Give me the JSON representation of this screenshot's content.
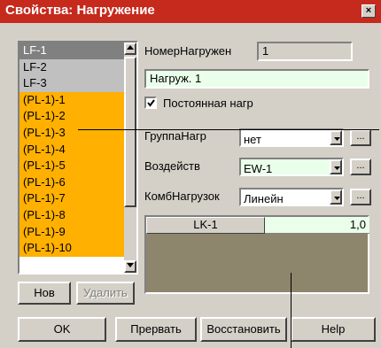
{
  "window": {
    "title": "Свойства: Нагружение",
    "close_glyph": "×"
  },
  "load_list": {
    "items": [
      {
        "label": "LF-1",
        "style": "sel"
      },
      {
        "label": "LF-2",
        "style": "gray"
      },
      {
        "label": "LF-3",
        "style": "gray"
      },
      {
        "label": "(PL-1)-1",
        "style": "orange"
      },
      {
        "label": "(PL-1)-2",
        "style": "orange"
      },
      {
        "label": "(PL-1)-3",
        "style": "orange"
      },
      {
        "label": "(PL-1)-4",
        "style": "orange"
      },
      {
        "label": "(PL-1)-5",
        "style": "orange"
      },
      {
        "label": "(PL-1)-6",
        "style": "orange"
      },
      {
        "label": "(PL-1)-7",
        "style": "orange"
      },
      {
        "label": "(PL-1)-8",
        "style": "orange"
      },
      {
        "label": "(PL-1)-9",
        "style": "orange"
      },
      {
        "label": "(PL-1)-10",
        "style": "orange"
      }
    ],
    "new_button": "Нов",
    "delete_button": "Удалить"
  },
  "form": {
    "load_number_label": "НомерНагружен",
    "load_number_value": "1",
    "load_name_value": "Нагруж. 1",
    "permanent_label": "Постоянная нагр",
    "group_label": "ГруппаНагр",
    "group_value": "нет",
    "action_label": "Воздейств",
    "action_value": "EW-1",
    "combination_label": "КомбНагрузок",
    "combination_value": "Линейн",
    "ellipsis": "..."
  },
  "grid": {
    "header": "LK-1",
    "value": "1,0"
  },
  "buttons": {
    "ok": "OK",
    "abort": "Прервать",
    "restore": "Восстановить",
    "help": "Help"
  },
  "colors": {
    "title_bar": "#c52a1d",
    "face": "#d4d0c8",
    "highlight_orange": "#ffb000",
    "field_green": "#eaffea",
    "grid_bg": "#8e866c"
  }
}
